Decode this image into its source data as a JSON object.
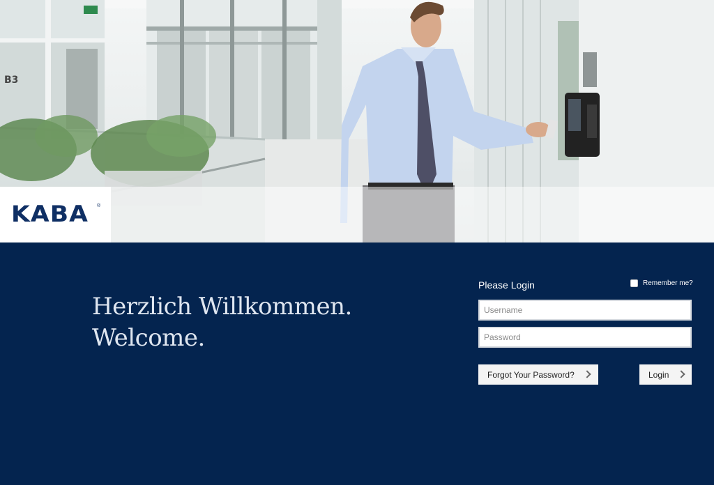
{
  "brand": {
    "logo_text": "KABA",
    "registered": "®"
  },
  "hero": {
    "floor_sign": "B3"
  },
  "welcome": {
    "line1": "Herzlich Willkommen.",
    "line2": "Welcome."
  },
  "login": {
    "title": "Please Login",
    "remember_label": "Remember me?",
    "remember_checked": false,
    "username_placeholder": "Username",
    "password_placeholder": "Password",
    "forgot_label": "Forgot Your Password?",
    "login_label": "Login"
  },
  "colors": {
    "background": "#04244f",
    "brand_blue": "#0f2f64",
    "button_bg": "#f4f4f4"
  },
  "icons": [
    "chevron-right-icon",
    "checkbox-icon"
  ]
}
